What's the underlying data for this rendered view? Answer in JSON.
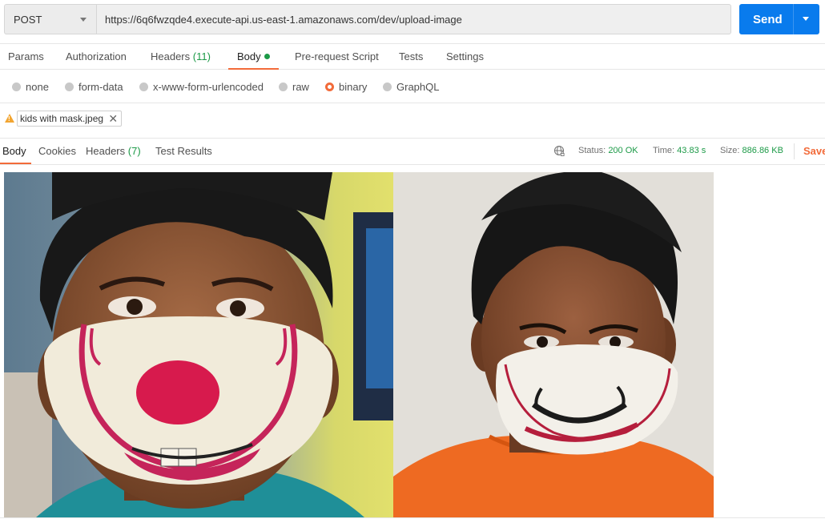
{
  "request": {
    "method": "POST",
    "url": "https://6q6fwzqde4.execute-api.us-east-1.amazonaws.com/dev/upload-image",
    "send_label": "Send"
  },
  "request_tabs": [
    {
      "label": "Params"
    },
    {
      "label": "Authorization"
    },
    {
      "label": "Headers",
      "count": "(11)"
    },
    {
      "label": "Body"
    },
    {
      "label": "Pre-request Script"
    },
    {
      "label": "Tests"
    },
    {
      "label": "Settings"
    }
  ],
  "body_types": [
    {
      "label": "none",
      "selected": false
    },
    {
      "label": "form-data",
      "selected": false
    },
    {
      "label": "x-www-form-urlencoded",
      "selected": false
    },
    {
      "label": "raw",
      "selected": false
    },
    {
      "label": "binary",
      "selected": true
    },
    {
      "label": "GraphQL",
      "selected": false
    }
  ],
  "file": {
    "name": "kids with mask.jpeg"
  },
  "response_tabs": [
    {
      "label": "Body"
    },
    {
      "label": "Cookies"
    },
    {
      "label": "Headers",
      "count": "(7)"
    },
    {
      "label": "Test Results"
    }
  ],
  "response_meta": {
    "status_label": "Status:",
    "status_value": "200 OK",
    "time_label": "Time:",
    "time_value": "43.83 s",
    "size_label": "Size:",
    "size_value": "886.86 KB",
    "save_label": "Save"
  },
  "colors": {
    "accent": "#f26b3a",
    "send": "#097bed",
    "success": "#1c9a47"
  }
}
